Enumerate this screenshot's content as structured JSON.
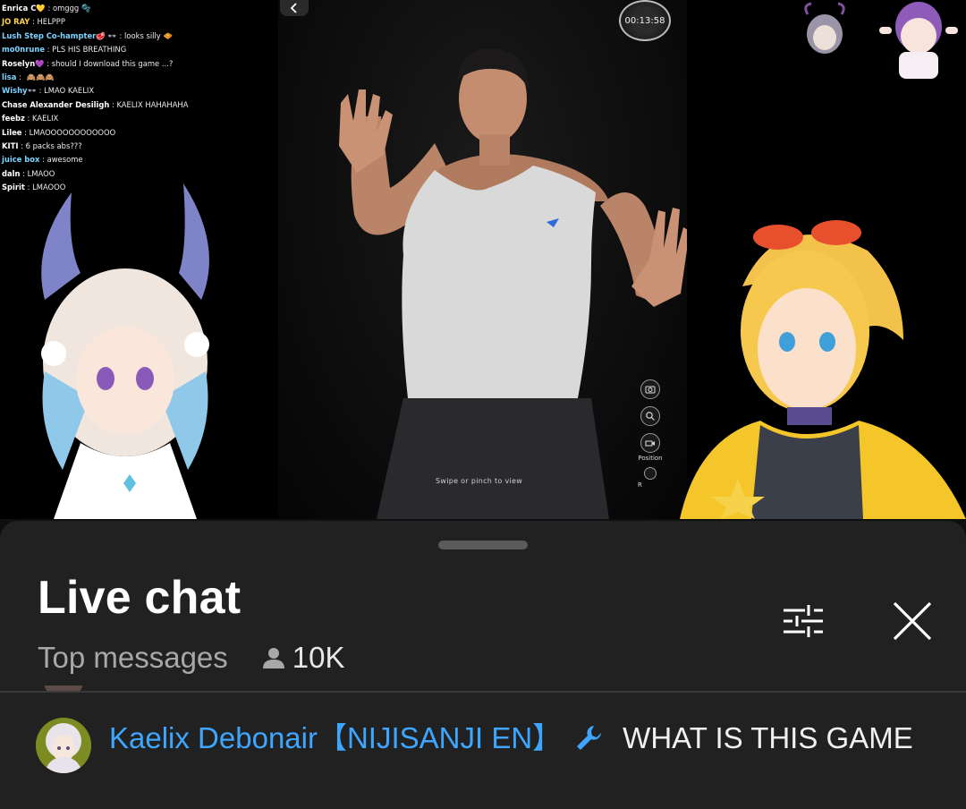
{
  "stream_chat": [
    {
      "name": "Enrica C",
      "badge": "💛",
      "sep": " : ",
      "text": "omggg",
      "emote": "🫧",
      "color": "#ffffff"
    },
    {
      "name": "JO RAY",
      "badge": "",
      "sep": " : ",
      "text": "HELPPP",
      "emote": "",
      "color": "#ffd54a"
    },
    {
      "name": "Lush Step Co-hampter",
      "badge": "🥩 👓",
      "sep": " : ",
      "text": "looks silly",
      "emote": "🧇",
      "color": "#7dd3ff"
    },
    {
      "name": "mo0nrune",
      "badge": "",
      "sep": " : ",
      "text": "PLS HIS BREATHING",
      "emote": "",
      "color": "#7dd3ff"
    },
    {
      "name": "Roselyn",
      "badge": "💜",
      "sep": " : ",
      "text": "should I download this game ...?",
      "emote": "",
      "color": "#ffffff"
    },
    {
      "name": "lisa",
      "badge": "",
      "sep": " : ",
      "text": "",
      "emote": "🙈🙈🙈",
      "color": "#7dd3ff"
    },
    {
      "name": "Wishy",
      "badge": "👓",
      "sep": " : ",
      "text": "LMAO KAELIX",
      "emote": "",
      "color": "#7dd3ff"
    },
    {
      "name": "Chase Alexander Desiligh",
      "badge": "",
      "sep": " : ",
      "text": "KAELIX HAHAHAHA",
      "emote": "",
      "color": "#ffffff"
    },
    {
      "name": "feebz",
      "badge": "",
      "sep": " : ",
      "text": "KAELIX",
      "emote": "",
      "color": "#ffffff"
    },
    {
      "name": "Lilee",
      "badge": "",
      "sep": " : ",
      "text": "LMAOOOOOOOOOOOO",
      "emote": "",
      "color": "#ffffff"
    },
    {
      "name": "KITI",
      "badge": "",
      "sep": " : ",
      "text": "6 packs abs???",
      "emote": "",
      "color": "#ffffff"
    },
    {
      "name": "juice box",
      "badge": "",
      "sep": " : ",
      "text": "awesome",
      "emote": "",
      "color": "#7dd3ff"
    },
    {
      "name": "daln",
      "badge": "",
      "sep": " : ",
      "text": "LMAOO",
      "emote": "",
      "color": "#ffffff"
    },
    {
      "name": "Spirit",
      "badge": "",
      "sep": " : ",
      "text": "LMAOOO",
      "emote": "",
      "color": "#ffffff"
    }
  ],
  "game": {
    "timer": "00:13:58",
    "swipe_hint": "Swipe or pinch to view",
    "position_label": "Position",
    "r_label": "R"
  },
  "live_chat": {
    "title": "Live chat",
    "mode": "Top messages",
    "viewers": "10K"
  },
  "message": {
    "author": "Kaelix Debonair【NIJISANJI EN】",
    "text": "WHAT IS THIS GAME",
    "badge_icon": "wrench-icon",
    "author_color": "#3ea6ff"
  }
}
